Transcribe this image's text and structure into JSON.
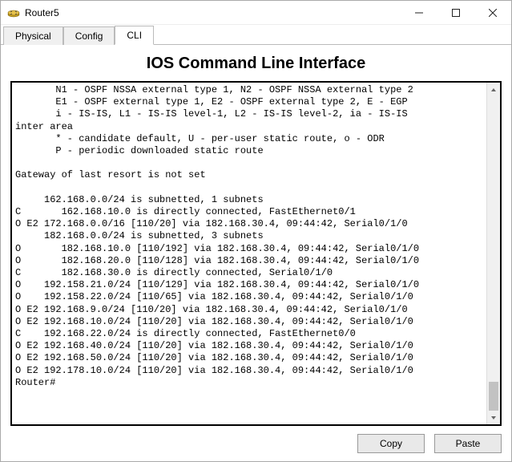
{
  "window": {
    "title": "Router5"
  },
  "tabs": {
    "physical": "Physical",
    "config": "Config",
    "cli": "CLI"
  },
  "heading": "IOS Command Line Interface",
  "terminal_lines": [
    "       N1 - OSPF NSSA external type 1, N2 - OSPF NSSA external type 2",
    "       E1 - OSPF external type 1, E2 - OSPF external type 2, E - EGP",
    "       i - IS-IS, L1 - IS-IS level-1, L2 - IS-IS level-2, ia - IS-IS",
    "inter area",
    "       * - candidate default, U - per-user static route, o - ODR",
    "       P - periodic downloaded static route",
    "",
    "Gateway of last resort is not set",
    "",
    "     162.168.0.0/24 is subnetted, 1 subnets",
    "C       162.168.10.0 is directly connected, FastEthernet0/1",
    "O E2 172.168.0.0/16 [110/20] via 182.168.30.4, 09:44:42, Serial0/1/0",
    "     182.168.0.0/24 is subnetted, 3 subnets",
    "O       182.168.10.0 [110/192] via 182.168.30.4, 09:44:42, Serial0/1/0",
    "O       182.168.20.0 [110/128] via 182.168.30.4, 09:44:42, Serial0/1/0",
    "C       182.168.30.0 is directly connected, Serial0/1/0",
    "O    192.158.21.0/24 [110/129] via 182.168.30.4, 09:44:42, Serial0/1/0",
    "O    192.158.22.0/24 [110/65] via 182.168.30.4, 09:44:42, Serial0/1/0",
    "O E2 192.168.9.0/24 [110/20] via 182.168.30.4, 09:44:42, Serial0/1/0",
    "O E2 192.168.10.0/24 [110/20] via 182.168.30.4, 09:44:42, Serial0/1/0",
    "C    192.168.22.0/24 is directly connected, FastEthernet0/0",
    "O E2 192.168.40.0/24 [110/20] via 182.168.30.4, 09:44:42, Serial0/1/0",
    "O E2 192.168.50.0/24 [110/20] via 182.168.30.4, 09:44:42, Serial0/1/0",
    "O E2 192.178.10.0/24 [110/20] via 182.168.30.4, 09:44:42, Serial0/1/0",
    "Router#"
  ],
  "buttons": {
    "copy": "Copy",
    "paste": "Paste"
  }
}
